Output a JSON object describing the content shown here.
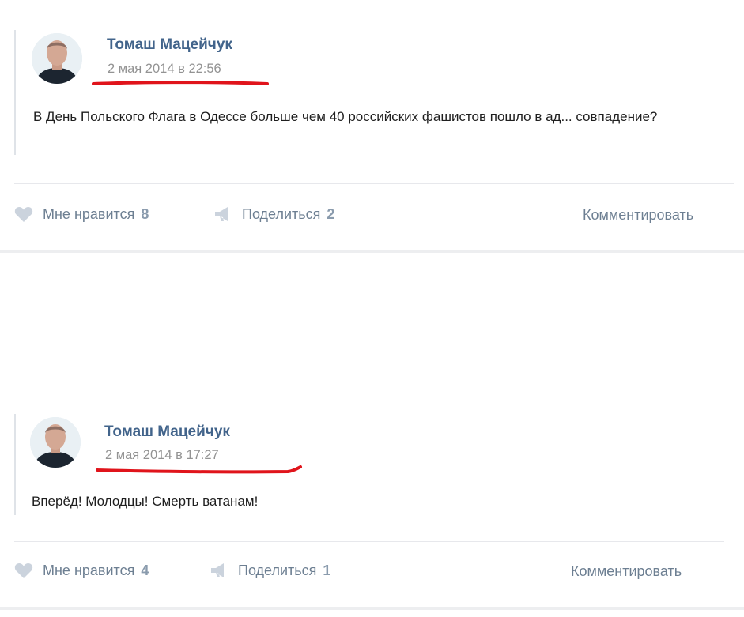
{
  "posts": [
    {
      "author": "Томаш Мацейчук",
      "date": "2 мая 2014 в 22:56",
      "text": "В День Польского Флага в Одессе больше чем 40 российских фашистов пошло в ад... совпадение?",
      "like_label": "Мне нравится",
      "like_count": "8",
      "share_label": "Поделиться",
      "share_count": "2",
      "comment_label": "Комментировать"
    },
    {
      "author": "Томаш Мацейчук",
      "date": "2 мая 2014 в 17:27",
      "text": "Вперёд! Молодцы! Смерть ватанам!",
      "like_label": "Мне нравится",
      "like_count": "4",
      "share_label": "Поделиться",
      "share_count": "1",
      "comment_label": "Комментировать"
    }
  ],
  "colors": {
    "author": "#42648b",
    "date": "#939393",
    "action": "#6d7f92",
    "icon": "#cbd3dd",
    "underline": "#e0141b"
  },
  "icons": {
    "like": "heart-icon",
    "share": "megaphone-icon"
  }
}
